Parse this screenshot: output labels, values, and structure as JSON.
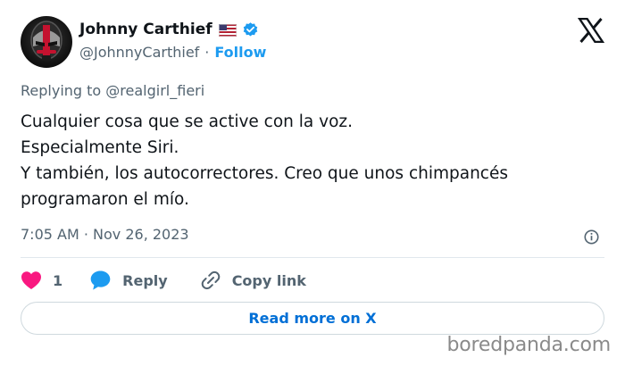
{
  "header": {
    "display_name": "Johnny Carthief",
    "handle": "@JohnnyCarthief",
    "separator": "·",
    "follow_label": "Follow"
  },
  "tweet": {
    "replying_to": "Replying to @realgirl_fieri",
    "lines": [
      "Cualquier cosa que se active con la voz.",
      "Especialmente Siri.",
      "Y también, los autocorrectores. Creo que unos chimpancés",
      "programaron el mío."
    ],
    "timestamp": "7:05 AM · Nov 26, 2023"
  },
  "actions": {
    "like_count": "1",
    "reply_label": "Reply",
    "copy_label": "Copy link"
  },
  "read_more_label": "Read more on X",
  "watermark": "boredpanda.com",
  "icons": {
    "flag": "us-flag-icon",
    "verified": "verified-badge-icon",
    "logo": "x-logo-icon",
    "info": "info-icon",
    "like": "heart-icon",
    "reply": "speech-bubble-icon",
    "copy": "link-icon"
  },
  "colors": {
    "accent": "#1d9bf0",
    "like": "#f91880",
    "text": "#0f1419",
    "muted": "#536471",
    "link": "#006fd6"
  }
}
